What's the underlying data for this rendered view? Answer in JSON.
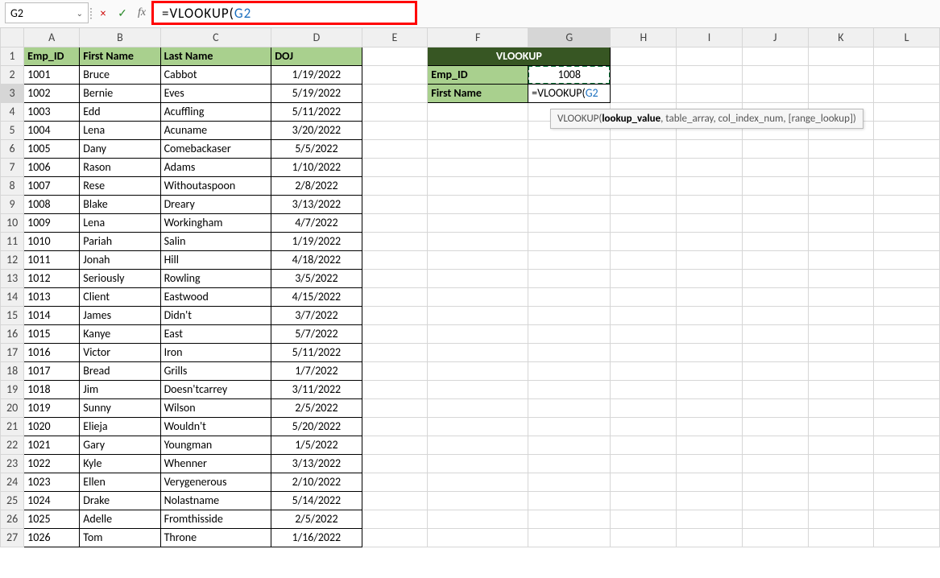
{
  "formula_bar": {
    "name_box": "G2",
    "formula_text_prefix": "=VLOOKUP(",
    "formula_text_ref": "G2",
    "cancel_icon": "×",
    "accept_icon": "✓",
    "fx_icon": "fx",
    "dropdown_icon": "⌄",
    "sep": "⁞"
  },
  "columns": [
    "A",
    "B",
    "C",
    "D",
    "E",
    "F",
    "G",
    "H",
    "I",
    "J",
    "K",
    "L"
  ],
  "headers": {
    "A": "Emp_ID",
    "B": "First Name",
    "C": "Last Name",
    "D": "DOJ"
  },
  "rows": [
    {
      "A": "1001",
      "B": "Bruce",
      "C": "Cabbot",
      "D": "1/19/2022"
    },
    {
      "A": "1002",
      "B": "Bernie",
      "C": "Eves",
      "D": "5/19/2022"
    },
    {
      "A": "1003",
      "B": "Edd",
      "C": "Acuffling",
      "D": "5/11/2022"
    },
    {
      "A": "1004",
      "B": "Lena",
      "C": "Acuname",
      "D": "3/20/2022"
    },
    {
      "A": "1005",
      "B": "Dany",
      "C": "Comebackaser",
      "D": "5/5/2022"
    },
    {
      "A": "1006",
      "B": "Rason",
      "C": "Adams",
      "D": "1/10/2022"
    },
    {
      "A": "1007",
      "B": "Rese",
      "C": "Withoutaspoon",
      "D": "2/8/2022"
    },
    {
      "A": "1008",
      "B": "Blake",
      "C": "Dreary",
      "D": "3/13/2022"
    },
    {
      "A": "1009",
      "B": "Lena",
      "C": "Workingham",
      "D": "4/7/2022"
    },
    {
      "A": "1010",
      "B": "Pariah",
      "C": "Salin",
      "D": "1/19/2022"
    },
    {
      "A": "1011",
      "B": "Jonah",
      "C": "Hill",
      "D": "4/18/2022"
    },
    {
      "A": "1012",
      "B": "Seriously",
      "C": "Rowling",
      "D": "3/5/2022"
    },
    {
      "A": "1013",
      "B": "Client",
      "C": "Eastwood",
      "D": "4/15/2022"
    },
    {
      "A": "1014",
      "B": "James",
      "C": "Didn't",
      "D": "3/7/2022"
    },
    {
      "A": "1015",
      "B": "Kanye",
      "C": "East",
      "D": "5/7/2022"
    },
    {
      "A": "1016",
      "B": "Victor",
      "C": "Iron",
      "D": "5/11/2022"
    },
    {
      "A": "1017",
      "B": "Bread",
      "C": "Grills",
      "D": "1/7/2022"
    },
    {
      "A": "1018",
      "B": "Jim",
      "C": "Doesn'tcarrey",
      "D": "3/11/2022"
    },
    {
      "A": "1019",
      "B": "Sunny",
      "C": "Wilson",
      "D": "2/5/2022"
    },
    {
      "A": "1020",
      "B": "Elieja",
      "C": "Wouldn't",
      "D": "5/20/2022"
    },
    {
      "A": "1021",
      "B": "Gary",
      "C": "Youngman",
      "D": "1/5/2022"
    },
    {
      "A": "1022",
      "B": "Kyle",
      "C": "Whenner",
      "D": "3/13/2022"
    },
    {
      "A": "1023",
      "B": "Ellen",
      "C": "Verygenerous",
      "D": "2/10/2022"
    },
    {
      "A": "1024",
      "B": "Drake",
      "C": "Nolastname",
      "D": "5/14/2022"
    },
    {
      "A": "1025",
      "B": "Adelle",
      "C": "Fromthisside",
      "D": "2/5/2022"
    },
    {
      "A": "1026",
      "B": "Tom",
      "C": "Throne",
      "D": "1/16/2022"
    }
  ],
  "lookup_block": {
    "title": "VLOOKUP",
    "emp_id_label": "Emp_ID",
    "emp_id_value": "1008",
    "first_name_label": "First Name",
    "first_name_value_prefix": "=VLOOKUP(",
    "first_name_value_ref": "G2"
  },
  "tooltip": {
    "fn": "VLOOKUP(",
    "bold_arg": "lookup_value",
    "rest": ", table_array, col_index_num, [range_lookup])"
  },
  "highlighted_col": "G",
  "highlighted_row": 3
}
